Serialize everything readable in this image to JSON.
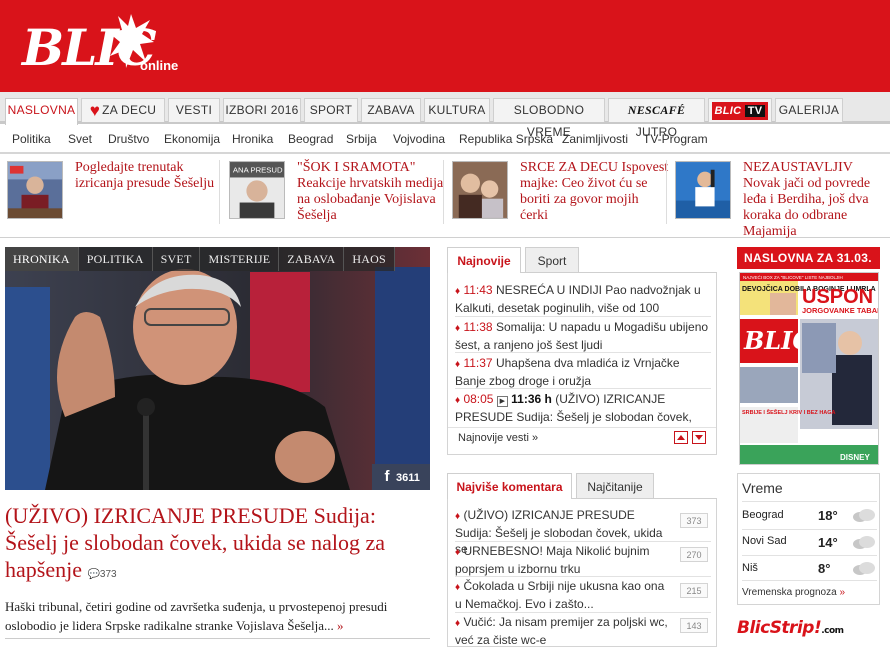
{
  "header": {
    "logo": "BLIC",
    "online": "online"
  },
  "mainnav": [
    {
      "label": "NASLOVNA"
    },
    {
      "label": "ZA DECU"
    },
    {
      "label": "VESTI"
    },
    {
      "label": "IZBORI 2016"
    },
    {
      "label": "SPORT"
    },
    {
      "label": "ZABAVA"
    },
    {
      "label": "KULTURA"
    },
    {
      "label": "SLOBODNO VREME"
    },
    {
      "label": "JUTRO",
      "brand": "NESCAFÉ"
    },
    {
      "label": "TV",
      "brand": "BLIC"
    },
    {
      "label": "GALERIJA"
    }
  ],
  "subnav": [
    "Politika",
    "Svet",
    "Društvo",
    "Ekonomija",
    "Hronika",
    "Beograd",
    "Srbija",
    "Vojvodina",
    "Republika Srpska",
    "Zanimljivosti",
    "TV-Program"
  ],
  "strip": [
    {
      "text": "Pogledajte trenutak izricanja presude Šešelju"
    },
    {
      "text": "\"ŠOK I SRAMOTA\" Reakcije hrvatskih medija na oslobađanje Vojislava Šešelja",
      "thumb_label": "ANA PRESUD"
    },
    {
      "text": "SRCE ZA DECU Ispovest majke: Ceo život ću se boriti za govor mojih ćerki"
    },
    {
      "text": "NEZAUSTAVLJIV Novak jači od povrede leđa i Berdiha, još dva koraka do odbrane Majamija"
    }
  ],
  "hero": {
    "tabs": [
      "HRONIKA",
      "POLITIKA",
      "SVET",
      "MISTERIJE",
      "ZABAVA",
      "HAOS"
    ],
    "fb_count": "3611",
    "title": "(UŽIVO) IZRICANJE PRESUDE Sudija: Šešelj je slobodan čovek, ukida se nalog za hapšenje",
    "comments": "373",
    "lead": "Haški tribunal, četiri godine od završetka suđenja, u prvostepenoj presudi oslobodio je lidera Srpske radikalne stranke Vojislava Šešelja...",
    "more": "»"
  },
  "news": {
    "tabs": [
      "Najnovije",
      "Sport"
    ],
    "items": [
      {
        "time": "11:43",
        "text": "NESREĆA U INDIJI Pao nadvožnjak u Kalkuti, desetak poginulih, više od 100"
      },
      {
        "time": "11:38",
        "text": "Somalija: U napadu u Mogadišu ubijeno šest, a ranjeno još šest ljudi"
      },
      {
        "time": "11:37",
        "text": "Uhapšena dva mladića iz Vrnjačke Banje zbog droge i oružja"
      },
      {
        "time": "08:05",
        "time2": "11:36 h",
        "text": "(UŽIVO) IZRICANJE PRESUDE Sudija: Šešelj je slobodan čovek,"
      }
    ],
    "footer": "Najnovije vesti »"
  },
  "comments_box": {
    "tabs": [
      "Najviše komentara",
      "Najčitanije"
    ],
    "items": [
      {
        "text": "(UŽIVO) IZRICANJE PRESUDE Sudija: Šešelj je slobodan čovek, ukida se",
        "count": "373"
      },
      {
        "text": "URNEBESNO! Maja Nikolić bujnim poprsjem u izbornu trku",
        "count": "270"
      },
      {
        "text": "Čokolada u Srbiji nije ukusna kao ona u Nemačkoj. Evo i zašto...",
        "count": "215"
      },
      {
        "text": "Vučić: Ja nisam premijer za poljski wc, već za čiste wc-e",
        "count": "143"
      }
    ]
  },
  "naslovna": {
    "title": "NASLOVNA ZA 31.03.",
    "cover_top": "NAJVEĆI BOX ZA \"BLICOVE\" LISTE NAJBOLJIH",
    "cover_head1": "USPON",
    "cover_head2": "JORGOVANKE TABAKOVIĆ",
    "cover_side1": "DEVOJČICA DOBILA BOGINJE I UMRLA",
    "cover_side2": "SRBIJE I ŠEŠELJ KRIV I BEZ HAGA",
    "cover_brand": "DISNEY"
  },
  "weather": {
    "title": "Vreme",
    "cities": [
      {
        "name": "Beograd",
        "temp": "18°"
      },
      {
        "name": "Novi Sad",
        "temp": "14°"
      },
      {
        "name": "Niš",
        "temp": "8°"
      }
    ],
    "prognoza": "Vremenska prognoza",
    "more": "»"
  },
  "blicstrip": {
    "text": "BlicStrip!",
    "com": ".com"
  }
}
